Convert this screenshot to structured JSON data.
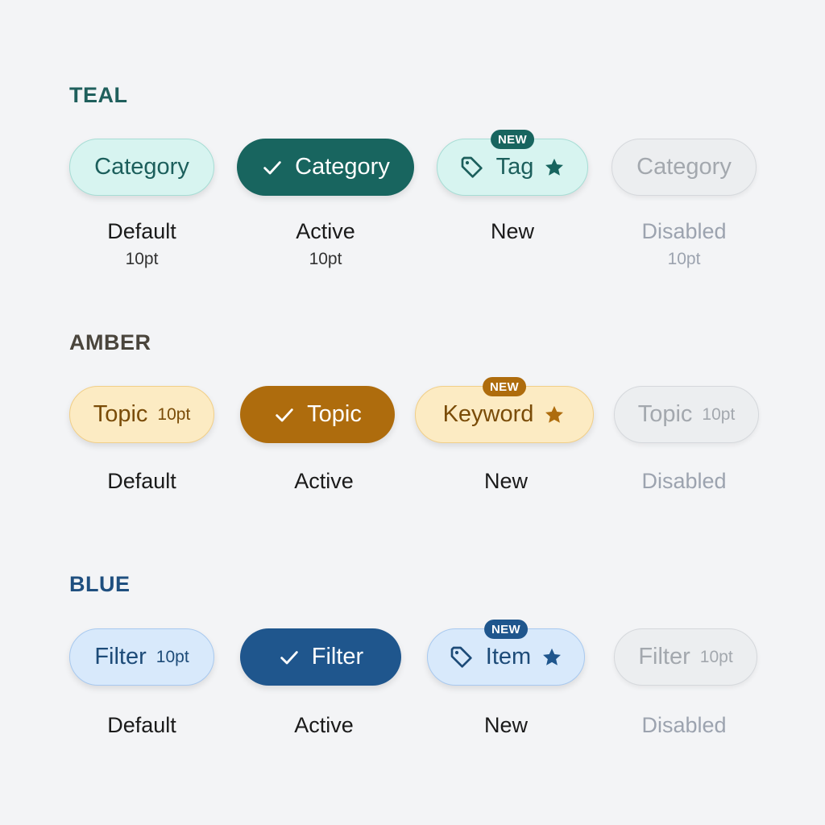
{
  "colors": {
    "teal": "#18655f",
    "amber": "#ae6c0d",
    "blue": "#1f568d",
    "disabled": "#a3a8ae",
    "background": "#f3f4f6"
  },
  "sections": {
    "teal": {
      "title": "TEAL",
      "default": {
        "label": "Category",
        "state": "Default",
        "size": "10pt"
      },
      "active": {
        "label": "Category",
        "state": "Active",
        "size": "10pt",
        "icon": "check-icon"
      },
      "new": {
        "badge": "NEW",
        "label": "Tag",
        "state": "New",
        "icons": [
          "tag-icon",
          "star-icon"
        ]
      },
      "disabled": {
        "label": "Category",
        "state": "Disabled",
        "size": "10pt"
      }
    },
    "amber": {
      "title": "AMBER",
      "default": {
        "label": "Topic",
        "size": "10pt",
        "state": "Default"
      },
      "active": {
        "label": "Topic",
        "state": "Active",
        "icon": "check-icon"
      },
      "new": {
        "badge": "NEW",
        "label": "Keyword",
        "state": "New",
        "icons": [
          "star-icon"
        ]
      },
      "disabled": {
        "label": "Topic",
        "size": "10pt",
        "state": "Disabled"
      }
    },
    "blue": {
      "title": "BLUE",
      "default": {
        "label": "Filter",
        "size": "10pt",
        "state": "Default"
      },
      "active": {
        "label": "Filter",
        "state": "Active",
        "icon": "check-icon"
      },
      "new": {
        "badge": "NEW",
        "label": "Item",
        "state": "New",
        "icons": [
          "tag-icon",
          "star-icon"
        ]
      },
      "disabled": {
        "label": "Filter",
        "size": "10pt",
        "state": "Disabled"
      }
    }
  }
}
